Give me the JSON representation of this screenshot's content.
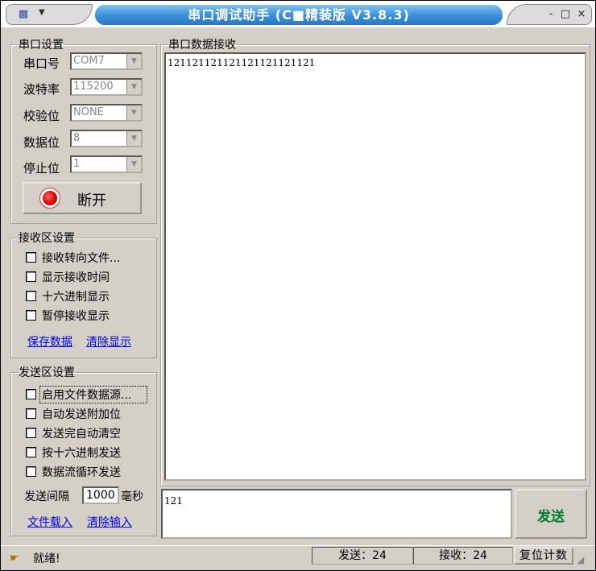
{
  "window": {
    "title": "串口调试助手 (C■精装版 V3.8.3)",
    "buttons": {
      "minimize": "-",
      "maximize": "□",
      "close": "×"
    }
  },
  "port_settings": {
    "group_title": "串口设置",
    "rows": [
      {
        "label": "串口号",
        "value": "COM7"
      },
      {
        "label": "波特率",
        "value": "115200"
      },
      {
        "label": "校验位",
        "value": "NONE"
      },
      {
        "label": "数据位",
        "value": "8"
      },
      {
        "label": "停止位",
        "value": "1"
      }
    ],
    "open_button": "断开",
    "lamp_color": "#e00000"
  },
  "receive_settings": {
    "group_title": "接收区设置",
    "options": [
      {
        "label": "接收转向文件...",
        "checked": false
      },
      {
        "label": "显示接收时间",
        "checked": false
      },
      {
        "label": "十六进制显示",
        "checked": false
      },
      {
        "label": "暂停接收显示",
        "checked": false
      }
    ],
    "save_link": "保存数据",
    "clear_link": "清除显示"
  },
  "send_settings": {
    "group_title": "发送区设置",
    "options": [
      {
        "label": "启用文件数据源...",
        "checked": false
      },
      {
        "label": "自动发送附加位",
        "checked": false
      },
      {
        "label": "发送完自动清空",
        "checked": false
      },
      {
        "label": "按十六进制发送",
        "checked": false
      },
      {
        "label": "数据流循环发送",
        "checked": false
      }
    ],
    "interval_label": "发送间隔",
    "interval_value": "1000",
    "interval_unit": "毫秒",
    "load_link": "文件载入",
    "clear_link": "清除输入"
  },
  "receive_area": {
    "group_title": "串口数据接收",
    "content": "121121121121121121121121"
  },
  "send_area": {
    "content": "121",
    "send_button": "发送",
    "send_color": "#007a2c"
  },
  "status": {
    "text": "就绪!",
    "sent": "发送：24",
    "received": "接收：24",
    "reset_button": "复位计数"
  }
}
